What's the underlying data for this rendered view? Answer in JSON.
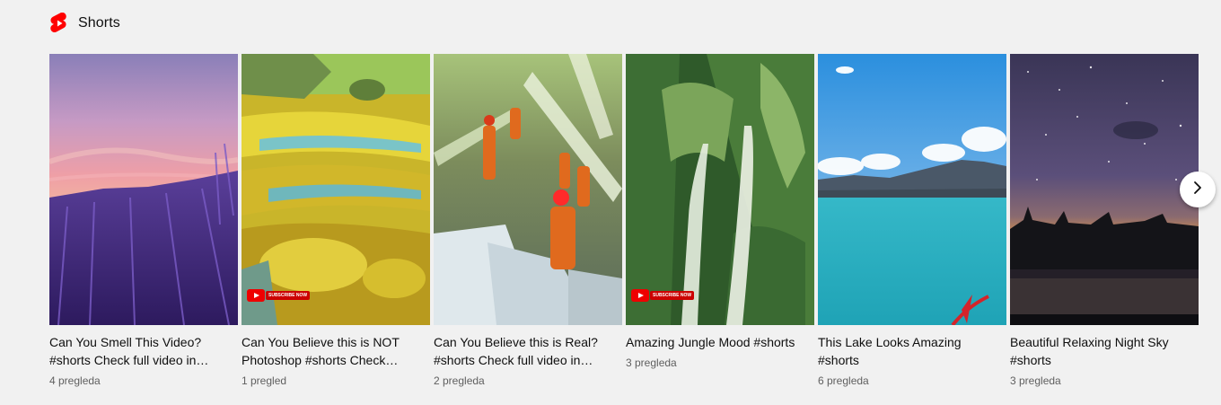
{
  "shelf": {
    "title": "Shorts",
    "logo_icon": "youtube-shorts-icon",
    "accent_color": "#ff0000"
  },
  "items": [
    {
      "title": "Can You Smell This Video? #shorts Check full video in…",
      "views": "4 pregleda"
    },
    {
      "title": "Can You Believe this is NOT Photoshop #shorts Check…",
      "views": "1 pregled",
      "badge": "SUBSCRIBE NOW"
    },
    {
      "title": "Can You Believe this is Real? #shorts Check full video in…",
      "views": "2 pregleda"
    },
    {
      "title": "Amazing Jungle Mood #shorts",
      "views": "3 pregleda",
      "badge": "SUBSCRIBE NOW"
    },
    {
      "title": "This Lake Looks Amazing #shorts",
      "views": "6 pregleda"
    },
    {
      "title": "Beautiful Relaxing Night Sky #shorts",
      "views": "3 pregleda"
    }
  ],
  "navigation": {
    "next_icon": "chevron-right-icon"
  }
}
